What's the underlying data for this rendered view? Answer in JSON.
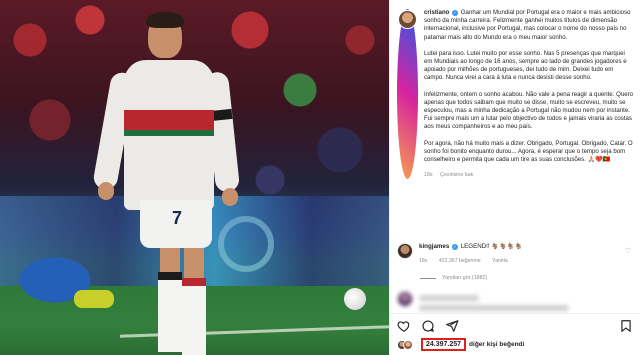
{
  "photo": {
    "jersey_number": "7"
  },
  "caption": {
    "username": "cristiano",
    "paragraphs": [
      "Ganhar um Mundial por Portugal era o maior e mais ambicioso sonho da minha carreira. Felizmente ganhei muitos títulos de dimensão internacional, inclusive por Portugal, mas colocar o nome do nosso país no patamar mais alto do Mundo era o meu maior sonho.",
      "Lutei para isso. Lutei muito por esse sonho. Nas 5 presenças que marquei em Mundiais ao longo de 16 anos, sempre ao lado de grandes jogadores e apoiado por milhões de portugueses, dei tudo de mim. Deixei tudo em campo. Nunca virei a cara à luta e nunca desisti desse sonho.",
      "Infelizmente, ontem o sonho acabou. Não vale a pena reagir a quente. Quero apenas que todos saibam que muito se disse, muito se escreveu, muito se especulou, mas a minha dedicação a Portugal não mudou nem por instante. Fui sempre mais um a lutar pelo objectivo de todos e jamais viraria as costas aos meus companheiros e ao meu país.",
      "Por agora, não há muito mais a dizer. Obrigado, Portugal. Obrigado, Catar. O sonho foi bonito enquanto durou... Agora, é esperar que o tempo seja bom conselheiro e permita que cada um tire as suas conclusões. 🙏🏼❤️🇵🇹"
    ],
    "time_ago": "18s",
    "translate_label": "Çevirisine bak"
  },
  "comment": {
    "username": "kingjames",
    "text": "LEGEND!! 🐐🐐🐐🐐",
    "time_ago": "18s",
    "likes": "422.367 beğenme",
    "reply_label": "Yanıtla",
    "view_replies": "Yanıtları gör (1882)"
  },
  "actions": {
    "like_icon": "heart-icon",
    "comment_icon": "comment-icon",
    "share_icon": "paper-plane-icon",
    "save_icon": "bookmark-icon"
  },
  "likes": {
    "count": "24.397.257",
    "suffix": "diğer kişi beğendi"
  },
  "colors": {
    "highlight_box": "#e0201d",
    "verified": "#3897f0"
  }
}
